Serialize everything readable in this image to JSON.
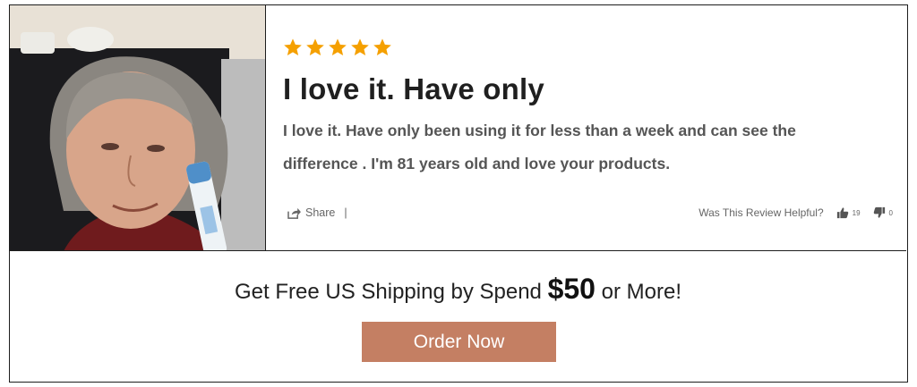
{
  "review": {
    "rating": 5,
    "rating_max": 5,
    "star_color": "#f5a000",
    "title": "I love it. Have only",
    "body": "I love it. Have only been using it for less than a week and can see the difference . I'm 81 years old and love your products.",
    "share_label": "Share",
    "separator": "|",
    "helpful_label": "Was This Review Helpful?",
    "helpful_up_count": "19",
    "helpful_down_count": "0"
  },
  "promo": {
    "text_before": "Get Free US Shipping by Spend",
    "amount": "$50",
    "text_after": "or More!"
  },
  "cta": {
    "label": "Order Now",
    "color": "#c47f63"
  }
}
